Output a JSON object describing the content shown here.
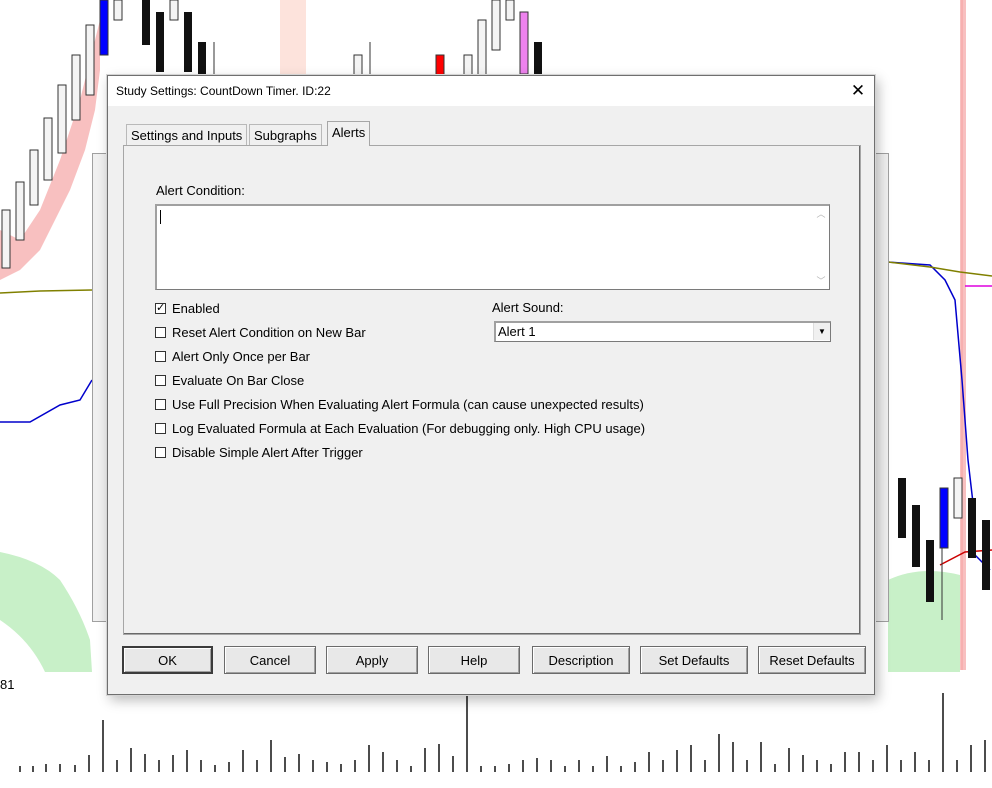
{
  "dialog": {
    "title": "Study Settings: CountDown Timer. ID:22",
    "close_glyph": "✕"
  },
  "tabs": [
    {
      "label": "Settings and Inputs",
      "active": false
    },
    {
      "label": "Subgraphs",
      "active": false
    },
    {
      "label": "Alerts",
      "active": true
    }
  ],
  "alerts": {
    "condition_label": "Alert Condition:",
    "condition_value": "",
    "sound_label": "Alert Sound:",
    "sound_value": "Alert 1",
    "options": [
      {
        "label": "Enabled",
        "checked": true
      },
      {
        "label": "Reset Alert Condition on New Bar",
        "checked": false
      },
      {
        "label": "Alert Only Once per Bar",
        "checked": false
      },
      {
        "label": "Evaluate On Bar Close",
        "checked": false
      },
      {
        "label": "Use Full Precision When Evaluating Alert Formula (can cause unexpected results)",
        "checked": false
      },
      {
        "label": "Log Evaluated Formula at Each Evaluation (For debugging only. High CPU usage)",
        "checked": false
      },
      {
        "label": "Disable Simple Alert After Trigger",
        "checked": false
      }
    ]
  },
  "buttons": {
    "ok": "OK",
    "cancel": "Cancel",
    "apply": "Apply",
    "help": "Help",
    "description": "Description",
    "set_defaults": "Set Defaults",
    "reset_defaults": "Reset Defaults"
  },
  "background": {
    "axis_label": "81",
    "colors": {
      "up_candle": "#0000ff",
      "highlight_candle": "#ff0000",
      "magenta_candle": "#ee82ee",
      "band_fill": "#f8c0c0",
      "cloud_fill": "#c8f0c8",
      "ma_line": "#0000cc",
      "olive_line": "#808000"
    }
  },
  "icons": {
    "checkmark": "✓",
    "dropdown_arrow": "▼",
    "scroll_up": "︿",
    "scroll_down": "﹀"
  }
}
